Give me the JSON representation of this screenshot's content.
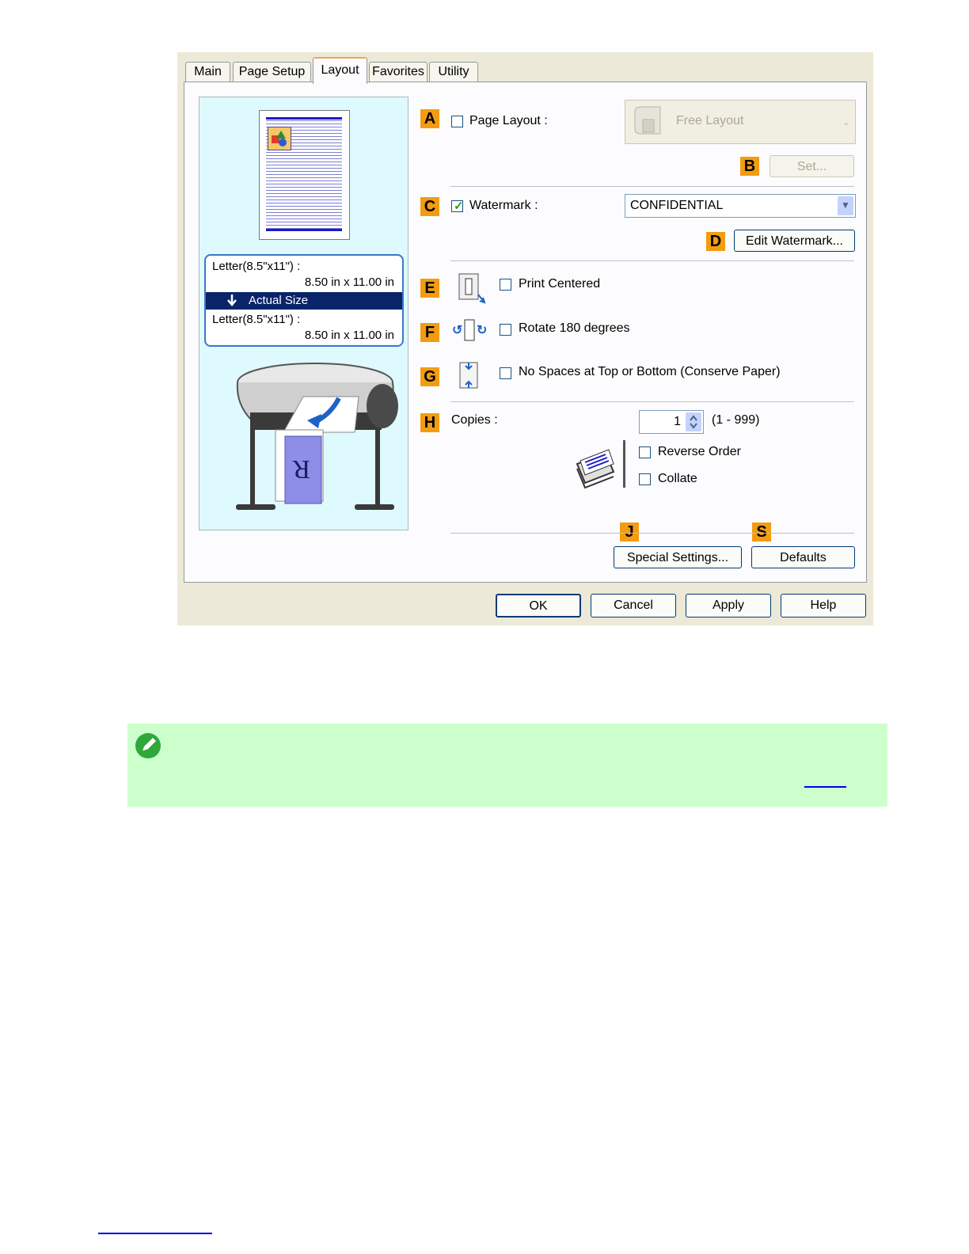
{
  "tabs": [
    "Main",
    "Page Setup",
    "Layout",
    "Favorites",
    "Utility"
  ],
  "active_tab": "Layout",
  "preview": {
    "paper_line1": "Letter(8.5\"x11\") :",
    "paper_line2": "8.50 in x 11.00 in",
    "size_mode": "Actual Size",
    "output_line1": "Letter(8.5\"x11\") :",
    "output_line2": "8.50 in x 11.00 in"
  },
  "markers": {
    "a": "A",
    "b": "B",
    "c": "C",
    "d": "D",
    "e": "E",
    "f": "F",
    "g": "G",
    "h": "H",
    "j": "J",
    "s": "S"
  },
  "page_layout": {
    "label": "Page Layout :",
    "checked": false,
    "value": "Free Layout",
    "set_button": "Set..."
  },
  "watermark": {
    "label": "Watermark :",
    "checked": true,
    "value": "CONFIDENTIAL",
    "edit_button": "Edit Watermark..."
  },
  "options": {
    "print_centered": {
      "label": "Print Centered",
      "checked": false
    },
    "rotate": {
      "label": "Rotate 180 degrees",
      "checked": false
    },
    "no_spaces": {
      "label": "No Spaces at Top or Bottom (Conserve Paper)",
      "checked": false
    }
  },
  "copies": {
    "label": "Copies :",
    "value": "1",
    "range": "(1 - 999)",
    "reverse_order": "Reverse Order",
    "collate": "Collate"
  },
  "buttons": {
    "special_settings": "Special Settings...",
    "defaults": "Defaults",
    "ok": "OK",
    "cancel": "Cancel",
    "apply": "Apply",
    "help": "Help"
  },
  "colors": {
    "marker": "#f39c12",
    "note_bg": "#ccffcc",
    "selection": "#0a246a"
  }
}
